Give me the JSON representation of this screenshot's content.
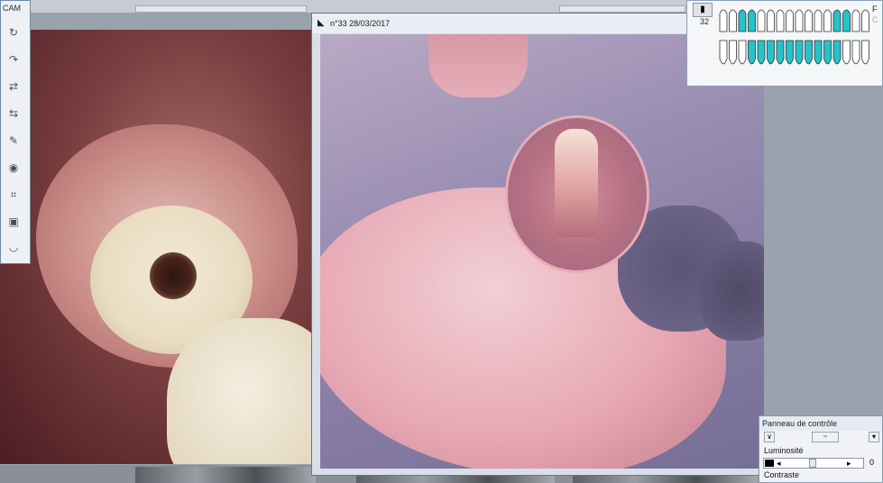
{
  "toolbar": {
    "title": "CAM",
    "buttons": [
      {
        "name": "rotate-180-icon",
        "glyph": "↻"
      },
      {
        "name": "rotate-90-icon",
        "glyph": "↷"
      },
      {
        "name": "flip-icon",
        "glyph": "⇄"
      },
      {
        "name": "mirror-icon",
        "glyph": "⇆"
      },
      {
        "name": "edit-icon",
        "glyph": "✎"
      },
      {
        "name": "eye-icon",
        "glyph": "◉"
      },
      {
        "name": "crop-icon",
        "glyph": "⌗"
      },
      {
        "name": "selection-icon",
        "glyph": "▣"
      },
      {
        "name": "mouth-icon",
        "glyph": "◡"
      }
    ]
  },
  "viewer": {
    "title": "n°33 28/03/2017"
  },
  "dental_chart": {
    "tooth_number": "32",
    "side_labels": [
      "F",
      "C"
    ]
  },
  "control_panel": {
    "title": "Panneau de contrôle",
    "brightness_label": "Luminosité",
    "brightness_value": "0",
    "contrast_label": "Contraste"
  },
  "colors": {
    "highlight_teeth": "#25c3c9",
    "window_border": "#5e7795"
  }
}
